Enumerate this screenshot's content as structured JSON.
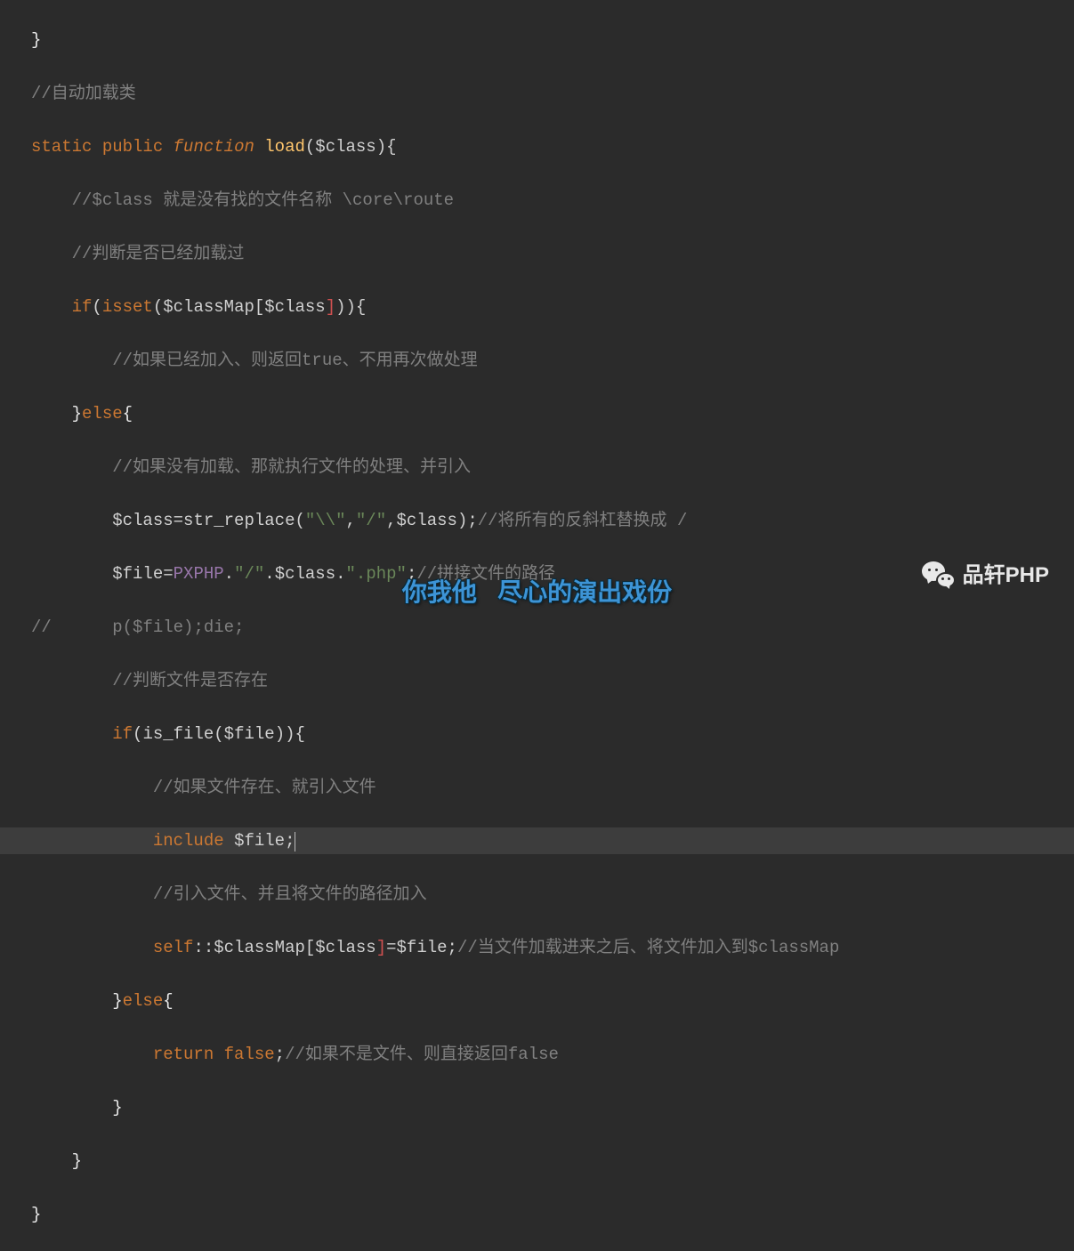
{
  "code": {
    "l1_brace": "}",
    "l2_cm": "//自动加载类",
    "l3_static": "static",
    "l3_public": "public",
    "l3_function": "function",
    "l3_name": "load",
    "l3_open": "(",
    "l3_var": "$class",
    "l3_close": "){",
    "l4_cm": "//$class 就是没有找的文件名称 \\core\\route",
    "l5_cm": "//判断是否已经加载过",
    "l6_if": "if",
    "l6_open": "(",
    "l6_isset": "isset",
    "l6_op2": "(",
    "l6_map": "$classMap",
    "l6_lb": "[",
    "l6_cls": "$class",
    "l6_rb": "]",
    "l6_close": ")){",
    "l7_cm": "//如果已经加入、则返回true、不用再次做处理",
    "l8_brace": "}",
    "l8_else": "else",
    "l8_open": "{",
    "l9_cm": "//如果没有加载、那就执行文件的处理、并引入",
    "l10_var": "$class",
    "l10_eq": "=",
    "l10_fn": "str_replace",
    "l10_open": "(",
    "l10_s1": "\"\\\\\"",
    "l10_c1": ",",
    "l10_s2": "\"/\"",
    "l10_c2": ",",
    "l10_arg": "$class",
    "l10_close": ");",
    "l10_cm": "//将所有的反斜杠替换成 /",
    "l11_var": "$file",
    "l11_eq": "=",
    "l11_const": "PXPHP",
    "l11_dot1": ".",
    "l11_s1": "\"/\"",
    "l11_dot2": ".",
    "l11_cls": "$class",
    "l11_dot3": ".",
    "l11_s2": "\".php\"",
    "l11_semi": ";",
    "l11_cm": "//拼接文件的路径",
    "l12_cm1": "//",
    "l12_cm2": "p($file);die;",
    "l13_cm": "//判断文件是否存在",
    "l14_if": "if",
    "l14_open": "(",
    "l14_fn": "is_file",
    "l14_op2": "(",
    "l14_var": "$file",
    "l14_close": ")){",
    "l15_cm": "//如果文件存在、就引入文件",
    "l16_inc": "include",
    "l16_var": "$file",
    "l16_semi": ";",
    "l17_cm": "//引入文件、并且将文件的路径加入",
    "l18_self": "self",
    "l18_cc": "::",
    "l18_map": "$classMap",
    "l18_lb": "[",
    "l18_cls": "$class",
    "l18_rb": "]",
    "l18_eq": "=",
    "l18_file": "$file",
    "l18_semi": ";",
    "l18_cm": "//当文件加载进来之后、将文件加入到$classMap",
    "l19_brace": "}",
    "l19_else": "else",
    "l19_open": "{",
    "l20_ret": "return",
    "l20_false": "false",
    "l20_semi": ";",
    "l20_cm": "//如果不是文件、则直接返回false",
    "l21_brace": "}",
    "l22_brace": "}",
    "l23_brace": "}"
  },
  "subtitle": "你我他   尽心的演出戏份",
  "watermark": "品轩PHP"
}
